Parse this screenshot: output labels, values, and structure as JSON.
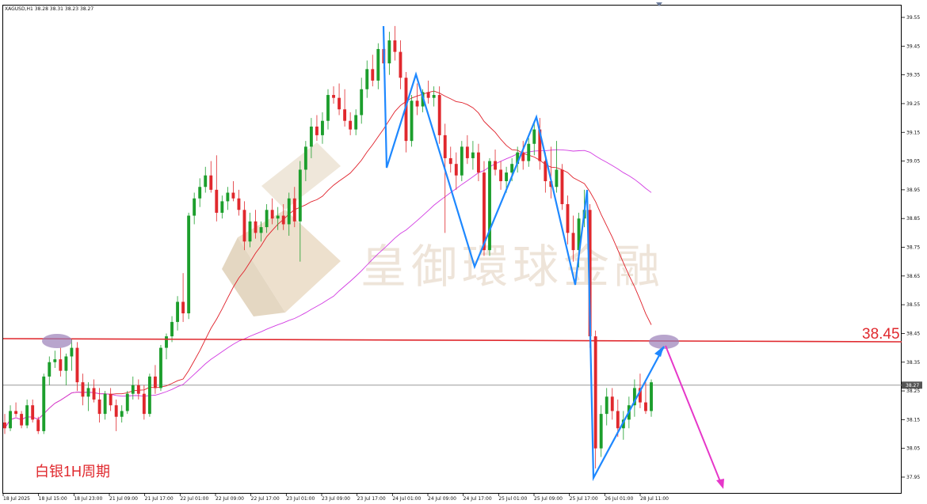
{
  "chart_data": {
    "type": "candlestick",
    "symbol_header": "XAGUSD,H1  38.28 38.31 38.23 38.27",
    "timeframe": "H1",
    "y_range": [
      37.91,
      39.58
    ],
    "y_ticks": [
      "39.55",
      "39.45",
      "39.35",
      "39.25",
      "39.15",
      "39.05",
      "38.95",
      "38.85",
      "38.75",
      "38.65",
      "38.55",
      "38.45",
      "38.35",
      "38.25",
      "38.15",
      "38.05",
      "37.95"
    ],
    "x_ticks": [
      "18 Jul 2025",
      "18 Jul 15:00",
      "18 Jul 23:00",
      "21 Jul 09:00",
      "21 Jul 17:00",
      "22 Jul 01:00",
      "22 Jul 09:00",
      "22 Jul 17:00",
      "23 Jul 01:00",
      "23 Jul 09:00",
      "23 Jul 17:00",
      "24 Jul 01:00",
      "24 Jul 09:00",
      "24 Jul 17:00",
      "25 Jul 01:00",
      "25 Jul 09:00",
      "25 Jul 17:00",
      "26 Jul 01:00",
      "28 Jul 11:00"
    ],
    "current_price": "38.27",
    "level": {
      "value": 38.42,
      "label": "38.45"
    },
    "period_label": "白银1H周期",
    "watermark": "皇御環球金融",
    "candles": [
      [
        38.14,
        38.17,
        38.1,
        38.12
      ],
      [
        38.12,
        38.2,
        38.11,
        38.18
      ],
      [
        38.18,
        38.21,
        38.16,
        38.17
      ],
      [
        38.17,
        38.18,
        38.12,
        38.13
      ],
      [
        38.13,
        38.22,
        38.12,
        38.2
      ],
      [
        38.2,
        38.22,
        38.14,
        38.15
      ],
      [
        38.15,
        38.16,
        38.1,
        38.11
      ],
      [
        38.11,
        38.31,
        38.1,
        38.3
      ],
      [
        38.3,
        38.37,
        38.27,
        38.35
      ],
      [
        38.35,
        38.39,
        38.33,
        38.36
      ],
      [
        38.36,
        38.4,
        38.3,
        38.32
      ],
      [
        38.32,
        38.38,
        38.27,
        38.37
      ],
      [
        38.37,
        38.43,
        38.32,
        38.4
      ],
      [
        38.4,
        38.42,
        38.25,
        38.28
      ],
      [
        38.28,
        38.31,
        38.2,
        38.23
      ],
      [
        38.23,
        38.28,
        38.18,
        38.26
      ],
      [
        38.26,
        38.29,
        38.21,
        38.22
      ],
      [
        38.22,
        38.26,
        38.14,
        38.17
      ],
      [
        38.17,
        38.25,
        38.15,
        38.24
      ],
      [
        38.24,
        38.26,
        38.18,
        38.2
      ],
      [
        38.2,
        38.22,
        38.11,
        38.16
      ],
      [
        38.16,
        38.2,
        38.14,
        38.18
      ],
      [
        38.18,
        38.25,
        38.17,
        38.24
      ],
      [
        38.24,
        38.3,
        38.22,
        38.27
      ],
      [
        38.27,
        38.29,
        38.22,
        38.24
      ],
      [
        38.24,
        38.27,
        38.15,
        38.17
      ],
      [
        38.17,
        38.31,
        38.16,
        38.3
      ],
      [
        38.3,
        38.34,
        38.24,
        38.26
      ],
      [
        38.26,
        38.41,
        38.25,
        38.4
      ],
      [
        38.4,
        38.45,
        38.36,
        38.44
      ],
      [
        38.44,
        38.51,
        38.42,
        38.49
      ],
      [
        38.49,
        38.58,
        38.46,
        38.56
      ],
      [
        38.56,
        38.66,
        38.49,
        38.52
      ],
      [
        38.52,
        38.87,
        38.5,
        38.86
      ],
      [
        38.86,
        38.94,
        38.83,
        38.92
      ],
      [
        38.92,
        38.99,
        38.89,
        38.96
      ],
      [
        38.96,
        39.03,
        38.94,
        39.0
      ],
      [
        39.0,
        39.05,
        38.94,
        38.95
      ],
      [
        38.95,
        39.07,
        38.84,
        38.87
      ],
      [
        38.87,
        38.93,
        38.85,
        38.91
      ],
      [
        38.91,
        38.96,
        38.88,
        38.94
      ],
      [
        38.94,
        38.98,
        38.91,
        38.92
      ],
      [
        38.92,
        38.95,
        38.86,
        38.88
      ],
      [
        38.88,
        38.91,
        38.74,
        38.77
      ],
      [
        38.77,
        38.87,
        38.75,
        38.84
      ],
      [
        38.84,
        38.88,
        38.78,
        38.8
      ],
      [
        38.8,
        38.84,
        38.77,
        38.82
      ],
      [
        38.82,
        38.9,
        38.8,
        38.88
      ],
      [
        38.88,
        38.92,
        38.83,
        38.85
      ],
      [
        38.85,
        38.89,
        38.81,
        38.86
      ],
      [
        38.86,
        38.9,
        38.81,
        38.83
      ],
      [
        38.83,
        38.94,
        38.79,
        38.92
      ],
      [
        38.92,
        38.96,
        38.82,
        38.84
      ],
      [
        38.84,
        39.05,
        38.7,
        39.02
      ],
      [
        39.02,
        39.12,
        38.98,
        39.1
      ],
      [
        39.1,
        39.2,
        39.06,
        39.17
      ],
      [
        39.17,
        39.21,
        39.12,
        39.14
      ],
      [
        39.14,
        39.22,
        39.11,
        39.19
      ],
      [
        39.19,
        39.3,
        39.16,
        39.28
      ],
      [
        39.28,
        39.31,
        39.25,
        39.27
      ],
      [
        39.27,
        39.32,
        39.21,
        39.23
      ],
      [
        39.23,
        39.3,
        39.17,
        39.19
      ],
      [
        39.19,
        39.22,
        39.14,
        39.16
      ],
      [
        39.16,
        39.23,
        39.14,
        39.21
      ],
      [
        39.21,
        39.34,
        39.18,
        39.3
      ],
      [
        39.3,
        39.4,
        39.27,
        39.37
      ],
      [
        39.37,
        39.42,
        39.31,
        39.33
      ],
      [
        39.33,
        39.46,
        39.3,
        39.44
      ],
      [
        39.44,
        39.48,
        39.37,
        39.39
      ],
      [
        39.39,
        39.5,
        39.35,
        39.47
      ],
      [
        39.47,
        39.52,
        39.4,
        39.43
      ],
      [
        39.43,
        39.47,
        39.3,
        39.34
      ],
      [
        39.34,
        39.36,
        39.08,
        39.12
      ],
      [
        39.12,
        39.28,
        39.1,
        39.26
      ],
      [
        39.26,
        39.32,
        39.21,
        39.24
      ],
      [
        39.24,
        39.3,
        39.22,
        39.29
      ],
      [
        39.29,
        39.33,
        39.25,
        39.27
      ],
      [
        39.27,
        39.31,
        39.24,
        39.28
      ],
      [
        39.28,
        39.31,
        39.11,
        39.14
      ],
      [
        39.14,
        39.18,
        38.8,
        39.06
      ],
      [
        39.06,
        39.1,
        39.01,
        39.04
      ],
      [
        39.04,
        39.08,
        38.95,
        39.0
      ],
      [
        39.0,
        39.12,
        38.98,
        39.1
      ],
      [
        39.1,
        39.14,
        39.04,
        39.06
      ],
      [
        39.06,
        39.12,
        39.02,
        39.08
      ],
      [
        39.08,
        39.11,
        38.98,
        39.01
      ],
      [
        39.01,
        39.05,
        38.72,
        38.74
      ],
      [
        38.74,
        39.06,
        38.72,
        39.05
      ],
      [
        39.05,
        39.09,
        39.0,
        39.02
      ],
      [
        39.02,
        39.05,
        38.95,
        38.98
      ],
      [
        38.98,
        39.03,
        38.94,
        39.01
      ],
      [
        39.01,
        39.06,
        38.98,
        39.04
      ],
      [
        39.04,
        39.1,
        39.01,
        39.08
      ],
      [
        39.08,
        39.12,
        39.02,
        39.05
      ],
      [
        39.05,
        39.13,
        39.03,
        39.11
      ],
      [
        39.11,
        39.19,
        39.07,
        39.16
      ],
      [
        39.16,
        39.2,
        39.02,
        39.05
      ],
      [
        39.05,
        39.08,
        38.94,
        38.98
      ],
      [
        38.98,
        39.1,
        38.92,
        38.96
      ],
      [
        38.96,
        39.12,
        38.94,
        39.02
      ],
      [
        39.02,
        39.04,
        38.88,
        38.9
      ],
      [
        38.9,
        38.93,
        38.76,
        38.8
      ],
      [
        38.8,
        38.86,
        38.7,
        38.74
      ],
      [
        38.74,
        38.87,
        38.68,
        38.85
      ],
      [
        38.85,
        38.95,
        38.82,
        38.88
      ],
      [
        38.88,
        38.9,
        38.4,
        38.44
      ],
      [
        38.44,
        38.46,
        37.98,
        38.05
      ],
      [
        38.05,
        38.2,
        38.02,
        38.17
      ],
      [
        38.17,
        38.26,
        38.13,
        38.23
      ],
      [
        38.23,
        38.26,
        38.15,
        38.18
      ],
      [
        38.18,
        38.22,
        38.09,
        38.12
      ],
      [
        38.12,
        38.18,
        38.08,
        38.15
      ],
      [
        38.15,
        38.23,
        38.12,
        38.2
      ],
      [
        38.2,
        38.29,
        38.16,
        38.26
      ],
      [
        38.26,
        38.31,
        38.19,
        38.21
      ],
      [
        38.21,
        38.28,
        38.17,
        38.18
      ],
      [
        38.18,
        38.29,
        38.16,
        38.28
      ]
    ]
  }
}
